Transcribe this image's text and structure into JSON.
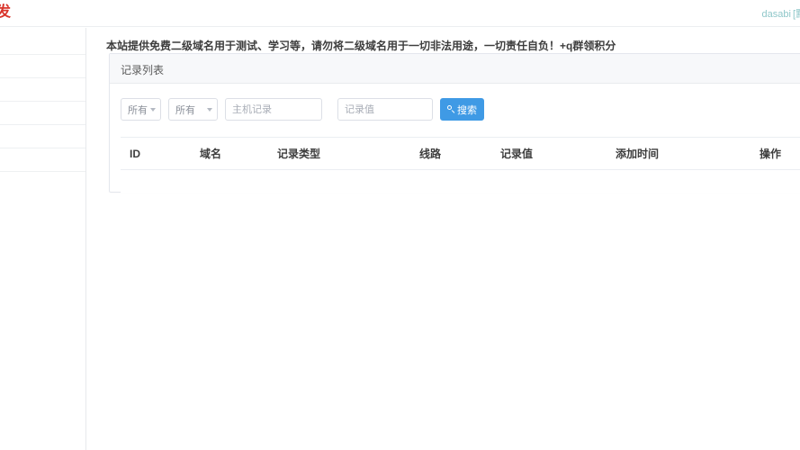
{
  "navbar": {
    "brand_text": "发",
    "brand_color": "#d9342b",
    "user_name": "dasabi",
    "user_tag": "[默",
    "user_color": "#8fc7c9"
  },
  "sidebar": {
    "items": [
      {
        "label": ""
      },
      {
        "label": ""
      },
      {
        "label": ""
      },
      {
        "label": ""
      },
      {
        "label": ""
      },
      {
        "label": ""
      }
    ]
  },
  "content": {
    "notice": "本站提供免费二级域名用于测试、学习等，请勿将二级域名用于一切非法用途，一切责任自负！+q群领积分"
  },
  "panel": {
    "title": "记录列表",
    "search": {
      "select_domain": {
        "value": "所有",
        "icon": "chevron-down-icon"
      },
      "select_type": {
        "value": "所有",
        "icon": "chevron-down-icon"
      },
      "input_host": {
        "value": "",
        "placeholder": "主机记录"
      },
      "input_value": {
        "value": "",
        "placeholder": "记录值"
      },
      "search_button": {
        "label": "搜索",
        "icon": "search-icon",
        "color": "#3f9ae5"
      }
    },
    "table": {
      "columns": [
        "ID",
        "域名",
        "记录类型",
        "线路",
        "记录值",
        "添加时间",
        "操作"
      ],
      "rows": []
    }
  }
}
